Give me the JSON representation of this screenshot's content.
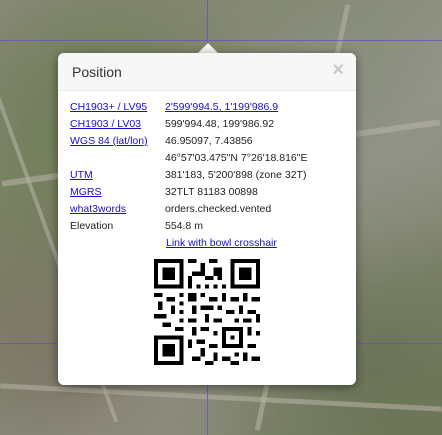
{
  "popup": {
    "title": "Position",
    "close_glyph": "×",
    "rows": [
      {
        "key": "CH1903+ / LV95",
        "value": "2'599'994.5, 1'199'986.9",
        "key_is_link": true,
        "value_is_link": true
      },
      {
        "key": "CH1903 / LV03",
        "value": "599'994.48, 199'986.92",
        "key_is_link": true,
        "value_is_link": false
      },
      {
        "key": "WGS 84 (lat/lon)",
        "value": "46.95097, 7.43856",
        "key_is_link": true,
        "value_is_link": false
      },
      {
        "key": "",
        "value": "46°57'03.475\"N 7°26'18.816\"E",
        "key_is_link": false,
        "value_is_link": false
      },
      {
        "key": "UTM",
        "value": "381'183, 5'200'898 (zone 32T)",
        "key_is_link": true,
        "value_is_link": false
      },
      {
        "key": "MGRS",
        "value": "32TLT 81183 00898",
        "key_is_link": true,
        "value_is_link": false
      },
      {
        "key": "what3words",
        "value": "orders.checked.vented",
        "key_is_link": true,
        "value_is_link": false
      },
      {
        "key": "Elevation",
        "value": "554.8 m",
        "key_is_link": false,
        "value_is_link": false
      }
    ],
    "bowl_link": "Link with bowl crosshair",
    "qr_icon": "qr-code-icon"
  },
  "colors": {
    "link": "#1a0dcc",
    "grid_line": "#6a4cc9"
  }
}
